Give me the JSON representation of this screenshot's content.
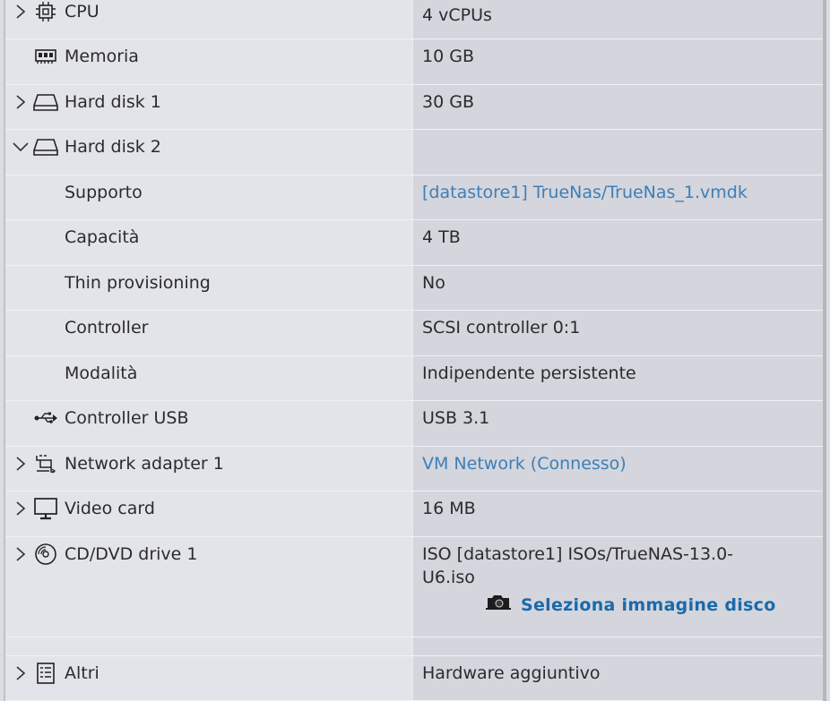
{
  "rows": [
    {
      "label": "CPU",
      "value": "4 vCPUs",
      "icon": "cpu-icon",
      "caret": "right"
    },
    {
      "label": "Memoria",
      "value": "10 GB",
      "icon": "memory-icon",
      "caret": "none"
    },
    {
      "label": "Hard disk 1",
      "value": "30 GB",
      "icon": "hard-disk-icon",
      "caret": "right"
    },
    {
      "label": "Hard disk 2",
      "value": "",
      "icon": "hard-disk-icon",
      "caret": "down"
    },
    {
      "label": "Supporto",
      "value": "[datastore1] TrueNas/TrueNas_1.vmdk",
      "sub": true,
      "link": true
    },
    {
      "label": "Capacità",
      "value": "4 TB",
      "sub": true
    },
    {
      "label": "Thin provisioning",
      "value": "No",
      "sub": true
    },
    {
      "label": "Controller",
      "value": "SCSI controller 0:1",
      "sub": true
    },
    {
      "label": "Modalità",
      "value": "Indipendente persistente",
      "sub": true
    },
    {
      "label": "Controller USB",
      "value": "USB 3.1",
      "icon": "usb-icon",
      "caret": "none"
    },
    {
      "label": "Network adapter 1",
      "value": "VM Network (Connesso)",
      "icon": "network-adapter-icon",
      "caret": "right",
      "link": true
    },
    {
      "label": "Video card",
      "value": "16 MB",
      "icon": "monitor-icon",
      "caret": "right"
    },
    {
      "label": "CD/DVD drive 1",
      "value": "ISO [datastore1] ISOs/TrueNAS-13.0-U6.iso",
      "icon": "disc-icon",
      "caret": "right",
      "action": "Seleziona immagine disco"
    },
    {
      "label": "Altri",
      "value": "Hardware aggiuntivo",
      "icon": "list-icon",
      "caret": "right"
    }
  ],
  "colors": {
    "link": "#3d7fb6",
    "action": "#1a6aa9",
    "value_bg": "#d4d5dd",
    "label_bg": "#e3e4e9"
  }
}
